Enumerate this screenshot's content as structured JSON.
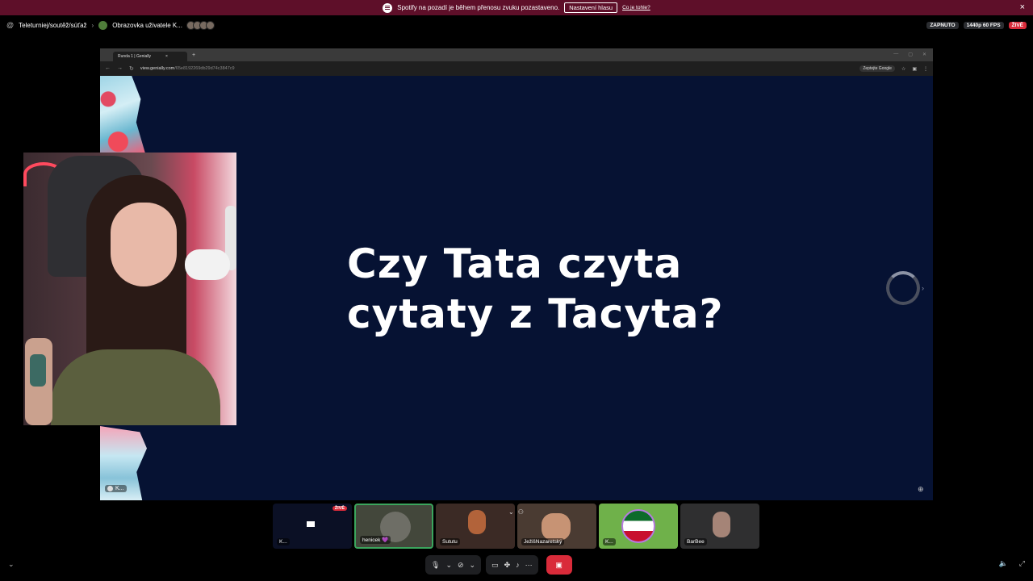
{
  "notification": {
    "message": "Spotify na pozadí je během přenosu zvuku pozastaveno.",
    "button": "Nastavení hlasu",
    "link": "Co je tohle?",
    "close": "×"
  },
  "topbar": {
    "channel": "Teleturniej/soutěž/súťaž",
    "stream_title": "Obrazovka uživatele K...",
    "status_on": "ZAPNUTO",
    "quality": "1440p 60 FPS",
    "live": "ŽIVĚ"
  },
  "browser": {
    "tab_title": "Runda 1 | Genially",
    "url_host": "view.genially.com",
    "url_path": "/65e8192269db29d74c3847c9",
    "google_button": "Zeptejte Google"
  },
  "slide": {
    "title_line1": "Czy Tata czyta",
    "title_line2": "cytaty z Tacyta?"
  },
  "stream_tile_label": "K...",
  "participants": [
    {
      "name": "K...",
      "badge": "ŽIVĚ"
    },
    {
      "name": "henicek 💜"
    },
    {
      "name": "Sututu"
    },
    {
      "name": "JežišNazaretský"
    },
    {
      "name": "K..."
    },
    {
      "name": "BarBee"
    }
  ],
  "icons": {
    "chevron": "›",
    "close": "×",
    "mic": "mic-icon",
    "camera_off": "camera-off-icon",
    "screen": "screen-share-icon",
    "activities": "activities-icon",
    "soundboard": "soundboard-icon",
    "more": "more-icon",
    "end_call": "end-call-icon",
    "volume": "volume-icon",
    "fullscreen": "fullscreen-icon"
  },
  "colors": {
    "banner": "#5e0f29",
    "slide_bg": "#061233",
    "live_red": "#d92b3a",
    "speaking_green": "#3ba55d"
  }
}
